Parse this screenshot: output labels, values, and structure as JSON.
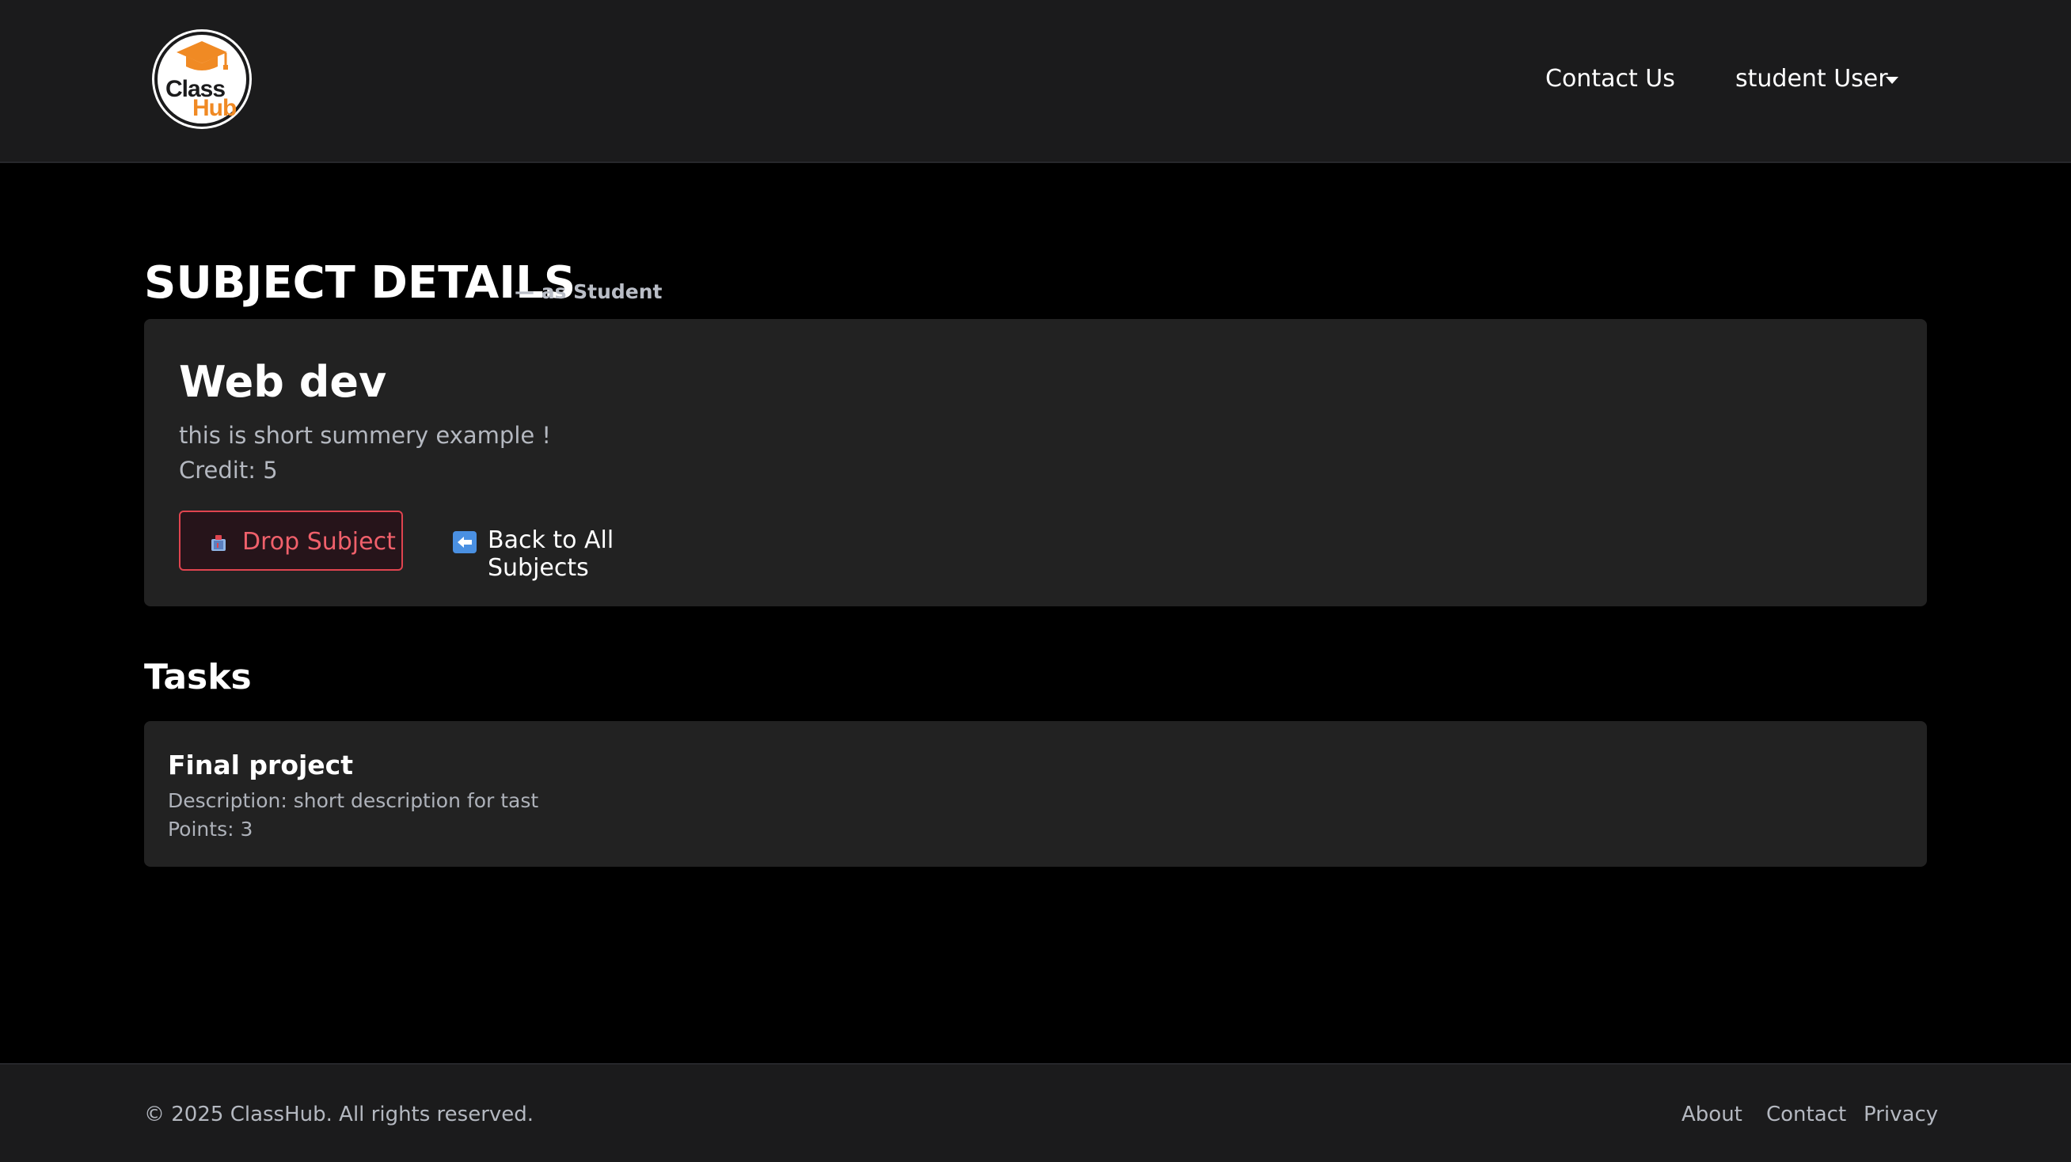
{
  "brand": {
    "line1": "Class",
    "line2": "Hub",
    "accent": "#f08a24",
    "icon": "graduation-cap-icon"
  },
  "nav": {
    "contact_label": "Contact Us",
    "user_label": "student User"
  },
  "page": {
    "title": "SUBJECT DETAILS",
    "subtitle": "— as Student"
  },
  "subject": {
    "name": "Web dev",
    "summary": "this is short summery example !",
    "credit": "Credit: 5",
    "drop_label": "Drop Subject",
    "drop_icon": "trash-bin-icon",
    "drop_color": "#f0606b",
    "back_label": "Back to All Subjects",
    "back_icon": "back-arrow-icon"
  },
  "tasks": {
    "heading": "Tasks",
    "items": [
      {
        "title": "Final project",
        "description": "Description: short description for tast",
        "points": "Points: 3"
      }
    ]
  },
  "footer": {
    "copyright": "© 2025 ClassHub. All rights reserved.",
    "links": [
      "About",
      "Contact",
      "Privacy"
    ]
  }
}
